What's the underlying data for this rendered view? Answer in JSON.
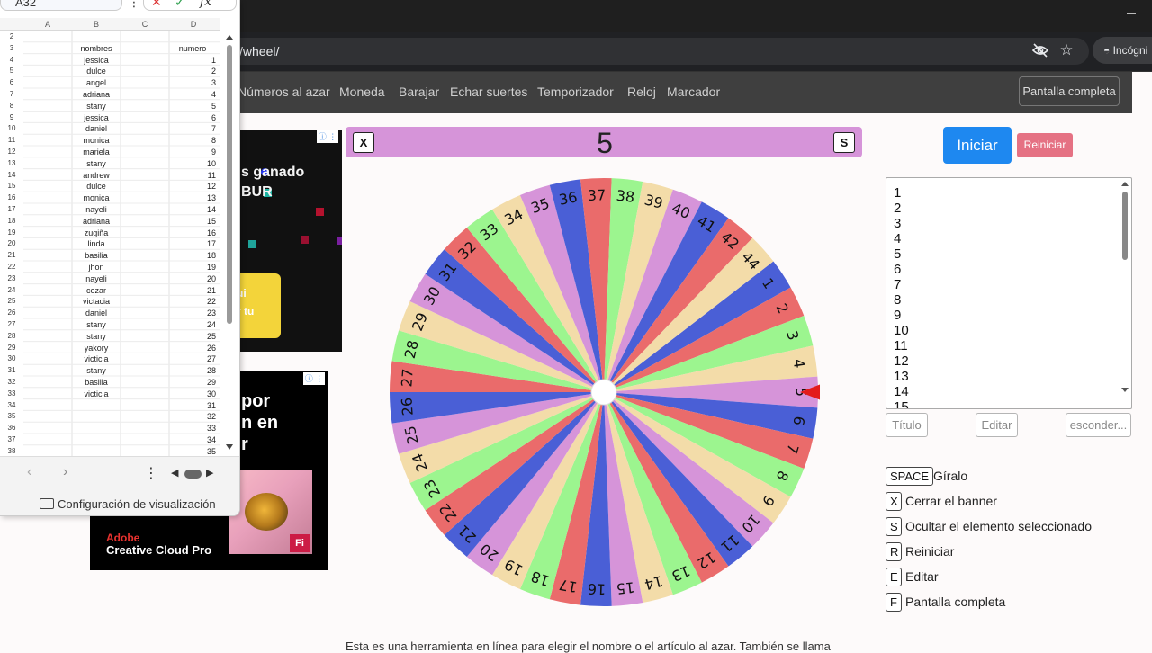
{
  "browser": {
    "url_fragment": "/wheel/",
    "incognito_label": "Incógni"
  },
  "nav": {
    "links": [
      "Números al azar",
      "Moneda",
      "Barajar",
      "Echar suertes",
      "Temporizador",
      "Reloj",
      "Marcador"
    ],
    "fullscreen": "Pantalla completa"
  },
  "ads": {
    "ad1_text": "s ganado\nBUR",
    "ad1_button": "ui\nr tu",
    "ad2_text": "por\nn en\nr",
    "ad2_brand1": "Adobe",
    "ad2_brand2": "Creative Cloud Pro",
    "ad2_badge": "Fi"
  },
  "wheel": {
    "close_key": "X",
    "hide_key": "S",
    "selected": "5",
    "segments": [
      {
        "n": "1",
        "color": "#4a5fd6"
      },
      {
        "n": "2",
        "color": "#ea6b6b"
      },
      {
        "n": "3",
        "color": "#9cf58f"
      },
      {
        "n": "4",
        "color": "#f3dca9"
      },
      {
        "n": "5",
        "color": "#d694d9"
      },
      {
        "n": "6",
        "color": "#4a5fd6"
      },
      {
        "n": "7",
        "color": "#ea6b6b"
      },
      {
        "n": "8",
        "color": "#9cf58f"
      },
      {
        "n": "9",
        "color": "#f3dca9"
      },
      {
        "n": "10",
        "color": "#d694d9"
      },
      {
        "n": "11",
        "color": "#4a5fd6"
      },
      {
        "n": "12",
        "color": "#ea6b6b"
      },
      {
        "n": "13",
        "color": "#9cf58f"
      },
      {
        "n": "14",
        "color": "#f3dca9"
      },
      {
        "n": "15",
        "color": "#d694d9"
      },
      {
        "n": "16",
        "color": "#4a5fd6"
      },
      {
        "n": "17",
        "color": "#ea6b6b"
      },
      {
        "n": "18",
        "color": "#9cf58f"
      },
      {
        "n": "19",
        "color": "#f3dca9"
      },
      {
        "n": "20",
        "color": "#d694d9"
      },
      {
        "n": "21",
        "color": "#4a5fd6"
      },
      {
        "n": "22",
        "color": "#ea6b6b"
      },
      {
        "n": "23",
        "color": "#9cf58f"
      },
      {
        "n": "24",
        "color": "#f3dca9"
      },
      {
        "n": "25",
        "color": "#d694d9"
      },
      {
        "n": "26",
        "color": "#4a5fd6"
      },
      {
        "n": "27",
        "color": "#ea6b6b"
      },
      {
        "n": "28",
        "color": "#9cf58f"
      },
      {
        "n": "29",
        "color": "#f3dca9"
      },
      {
        "n": "30",
        "color": "#d694d9"
      },
      {
        "n": "31",
        "color": "#4a5fd6"
      },
      {
        "n": "32",
        "color": "#ea6b6b"
      },
      {
        "n": "33",
        "color": "#9cf58f"
      },
      {
        "n": "34",
        "color": "#f3dca9"
      },
      {
        "n": "35",
        "color": "#d694d9"
      },
      {
        "n": "36",
        "color": "#4a5fd6"
      },
      {
        "n": "37",
        "color": "#ea6b6b"
      },
      {
        "n": "38",
        "color": "#9cf58f"
      },
      {
        "n": "39",
        "color": "#f3dca9"
      },
      {
        "n": "40",
        "color": "#d694d9"
      },
      {
        "n": "41",
        "color": "#4a5fd6"
      },
      {
        "n": "42",
        "color": "#ea6b6b"
      },
      {
        "n": "44",
        "color": "#f3dca9"
      }
    ],
    "pointer_color": "#e31b1b"
  },
  "controls": {
    "start": "Iniciar",
    "reset": "Reiniciar",
    "items": [
      "1",
      "2",
      "3",
      "4",
      "5",
      "6",
      "7",
      "8",
      "9",
      "10",
      "11",
      "12",
      "13",
      "14",
      "15"
    ],
    "title_btn": "Título",
    "edit_btn": "Editar",
    "hide_btn": "esconder..."
  },
  "shortcuts": [
    {
      "key": "SPACE",
      "label": "Gíralo"
    },
    {
      "key": "X",
      "label": "Cerrar el banner"
    },
    {
      "key": "S",
      "label": "Ocultar el elemento seleccionado"
    },
    {
      "key": "R",
      "label": "Reiniciar"
    },
    {
      "key": "E",
      "label": "Editar"
    },
    {
      "key": "F",
      "label": "Pantalla completa"
    }
  ],
  "bottom_text": "Esta es una herramienta en línea para elegir el nombre o el artículo al azar. También se llama",
  "sheet": {
    "namebox": "A32",
    "columns": [
      "A",
      "B",
      "C",
      "D"
    ],
    "header_row": {
      "row": "3",
      "b": "nombres",
      "d": "numero"
    },
    "rows": [
      {
        "row": "2",
        "b": "",
        "d": ""
      },
      {
        "row": "4",
        "b": "jessica",
        "d": "1"
      },
      {
        "row": "5",
        "b": "dulce",
        "d": "2"
      },
      {
        "row": "6",
        "b": "angel",
        "d": "3"
      },
      {
        "row": "7",
        "b": "adriana",
        "d": "4"
      },
      {
        "row": "8",
        "b": "stany",
        "d": "5"
      },
      {
        "row": "9",
        "b": "jessica",
        "d": "6"
      },
      {
        "row": "10",
        "b": "daniel",
        "d": "7"
      },
      {
        "row": "11",
        "b": "monica",
        "d": "8"
      },
      {
        "row": "12",
        "b": "mariela",
        "d": "9"
      },
      {
        "row": "13",
        "b": "stany",
        "d": "10"
      },
      {
        "row": "14",
        "b": "andrew",
        "d": "11"
      },
      {
        "row": "15",
        "b": "dulce",
        "d": "12"
      },
      {
        "row": "16",
        "b": "monica",
        "d": "13"
      },
      {
        "row": "17",
        "b": "nayeli",
        "d": "14"
      },
      {
        "row": "18",
        "b": "adriana",
        "d": "15"
      },
      {
        "row": "19",
        "b": "zugiña",
        "d": "16"
      },
      {
        "row": "20",
        "b": "linda",
        "d": "17"
      },
      {
        "row": "21",
        "b": "basilia",
        "d": "18"
      },
      {
        "row": "22",
        "b": "jhon",
        "d": "19"
      },
      {
        "row": "23",
        "b": "nayeli",
        "d": "20"
      },
      {
        "row": "24",
        "b": "cezar",
        "d": "21"
      },
      {
        "row": "25",
        "b": "victacia",
        "d": "22"
      },
      {
        "row": "26",
        "b": "daniel",
        "d": "23"
      },
      {
        "row": "27",
        "b": "stany",
        "d": "24"
      },
      {
        "row": "28",
        "b": "stany",
        "d": "25"
      },
      {
        "row": "29",
        "b": "yakory",
        "d": "26"
      },
      {
        "row": "30",
        "b": "victicia",
        "d": "27"
      },
      {
        "row": "31",
        "b": "stany",
        "d": "28"
      },
      {
        "row": "32",
        "b": "basilia",
        "d": "29"
      },
      {
        "row": "33",
        "b": "victicia",
        "d": "30"
      },
      {
        "row": "34",
        "b": "",
        "d": "31"
      },
      {
        "row": "35",
        "b": "",
        "d": "32"
      },
      {
        "row": "36",
        "b": "",
        "d": "33"
      },
      {
        "row": "37",
        "b": "",
        "d": "34"
      },
      {
        "row": "38",
        "b": "",
        "d": "35"
      }
    ],
    "settings": "Configuración de visualización"
  }
}
